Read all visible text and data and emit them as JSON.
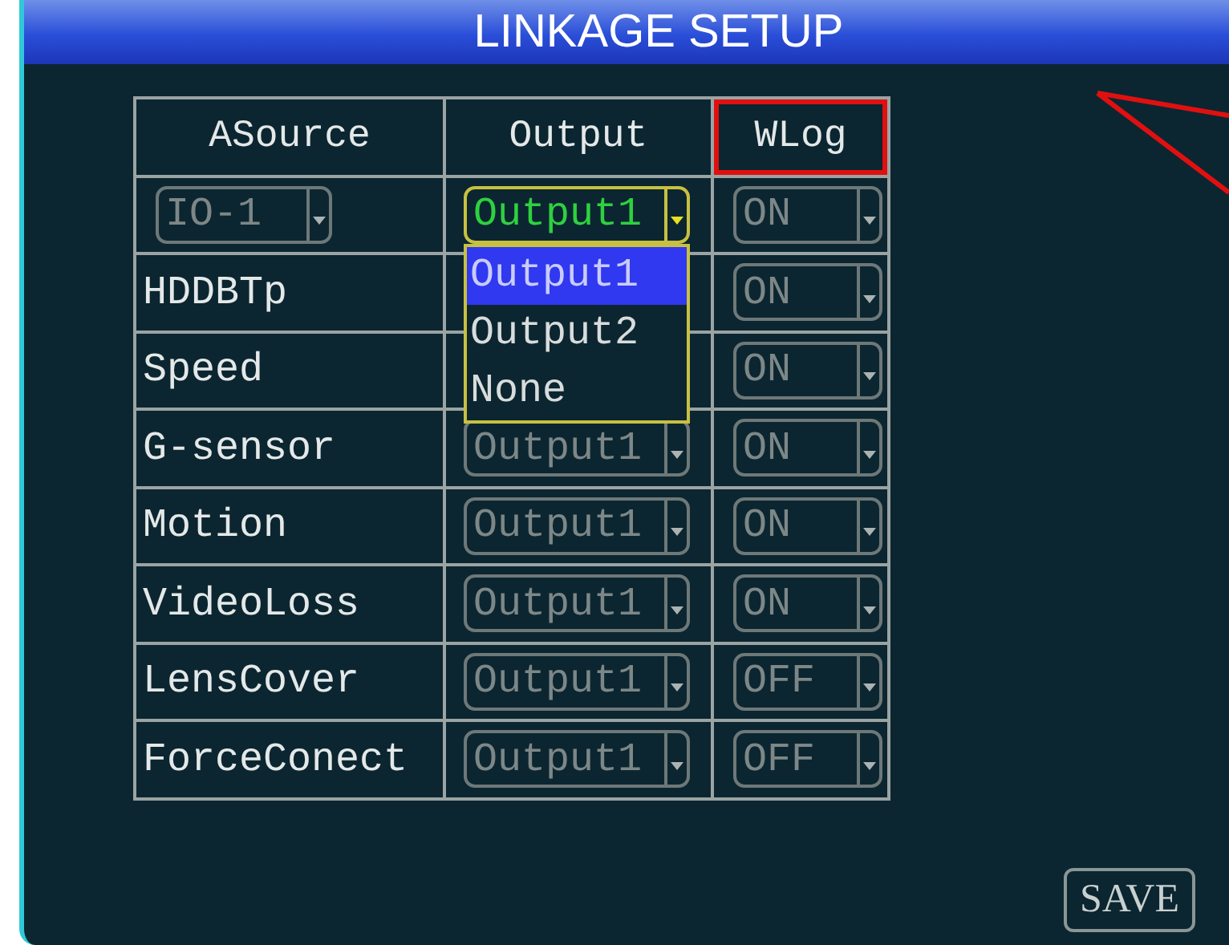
{
  "window": {
    "title": "LINKAGE SETUP",
    "callout_pointer": true
  },
  "table": {
    "columns": [
      {
        "label": "ASource",
        "highlighted": false
      },
      {
        "label": "Output",
        "highlighted": false
      },
      {
        "label": "WLog",
        "highlighted": true
      }
    ],
    "rows": [
      {
        "source": {
          "kind": "select",
          "text": "IO-1"
        },
        "output": {
          "text": "Output1",
          "focused": true,
          "menu": [
            {
              "label": "Output1",
              "selected": true
            },
            {
              "label": "Output2",
              "selected": false
            },
            {
              "label": "None",
              "selected": false
            }
          ]
        },
        "wlog": "ON"
      },
      {
        "source": {
          "kind": "label",
          "text": "HDDBTp"
        },
        "wlog": "ON"
      },
      {
        "source": {
          "kind": "label",
          "text": "Speed"
        },
        "wlog": "ON"
      },
      {
        "source": {
          "kind": "label",
          "text": "G-sensor"
        },
        "output": {
          "text": "Output1",
          "focused": false
        },
        "wlog": "ON"
      },
      {
        "source": {
          "kind": "label",
          "text": "Motion"
        },
        "output": {
          "text": "Output1",
          "focused": false
        },
        "wlog": "ON"
      },
      {
        "source": {
          "kind": "label",
          "text": "VideoLoss"
        },
        "output": {
          "text": "Output1",
          "focused": false
        },
        "wlog": "ON"
      },
      {
        "source": {
          "kind": "label",
          "text": "LensCover"
        },
        "output": {
          "text": "Output1",
          "focused": false
        },
        "wlog": "OFF"
      },
      {
        "source": {
          "kind": "label",
          "text": "ForceConect"
        },
        "output": {
          "text": "Output1",
          "focused": false
        },
        "wlog": "OFF"
      }
    ]
  },
  "save_button": "SAVE"
}
